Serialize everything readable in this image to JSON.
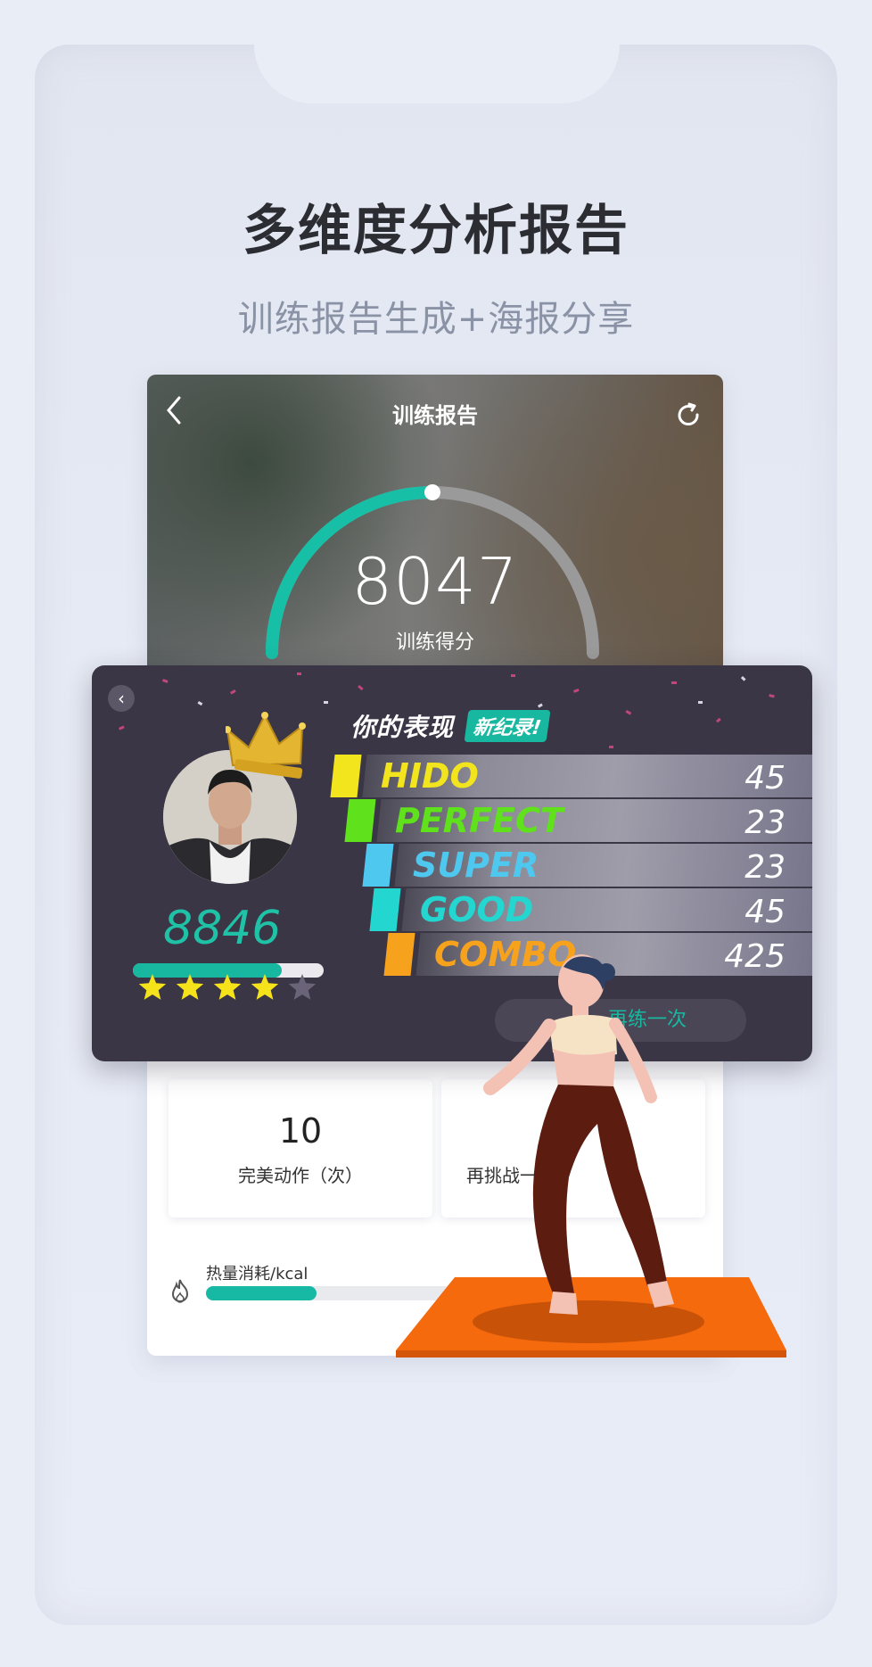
{
  "page": {
    "headline": "多维度分析报告",
    "subhead": "训练报告生成+海报分享"
  },
  "report": {
    "title": "训练报告",
    "score": "8047",
    "score_label": "训练得分",
    "perfect_count": "10",
    "perfect_label": "完美动作（次）",
    "retry_label_partial": "再挑战一次",
    "kcal_label": "热量消耗/kcal",
    "kcal_progress": 0.23,
    "gauge_progress": 0.5
  },
  "result": {
    "title": "你的表现",
    "badge": "新纪录!",
    "player_score": "8846",
    "level_progress": 0.78,
    "stars_filled": 4,
    "stars_total": 5,
    "retry_label": "再练一次",
    "grades": [
      {
        "name": "HIDO",
        "count": "45",
        "color": "#f2e51d",
        "tab": "#f2e51d"
      },
      {
        "name": "PERFECT",
        "count": "23",
        "color": "#5fe21c",
        "tab": "#5fe21c"
      },
      {
        "name": "SUPER",
        "count": "23",
        "color": "#4ec8ef",
        "tab": "#4ec8ef"
      },
      {
        "name": "GOOD",
        "count": "45",
        "color": "#23d6d0",
        "tab": "#23d6d0"
      },
      {
        "name": "COMBO",
        "count": "425",
        "color": "#f7a21c",
        "tab": "#f7a21c"
      }
    ]
  },
  "colors": {
    "accent": "#18b8a0",
    "background": "#e9edf6",
    "dark_card": "#3a3646"
  }
}
